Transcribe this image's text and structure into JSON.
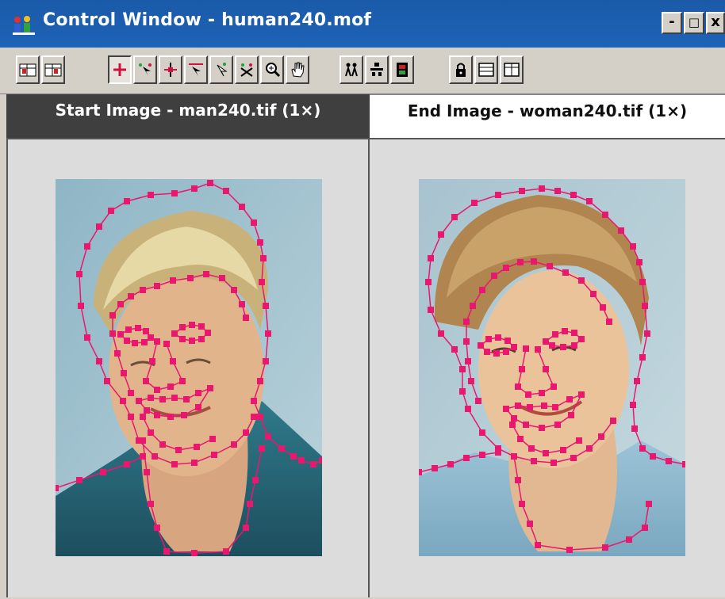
{
  "window": {
    "title": "Control Window - human240.mof",
    "controls": {
      "minimize": "-",
      "maximize": "□",
      "close": "x"
    }
  },
  "toolbar": {
    "buttons": [
      {
        "icon": "view-start-icon"
      },
      {
        "icon": "view-end-icon"
      },
      {
        "icon": "add-point-icon"
      },
      {
        "icon": "select-point-icon"
      },
      {
        "icon": "move-point-icon"
      },
      {
        "icon": "add-line-icon"
      },
      {
        "icon": "select-line-icon"
      },
      {
        "icon": "delete-point-icon"
      },
      {
        "icon": "zoom-icon"
      },
      {
        "icon": "pan-hand-icon"
      },
      {
        "icon": "morph-people-icon"
      },
      {
        "icon": "align-icon"
      },
      {
        "icon": "film-strip-icon"
      },
      {
        "icon": "lock-icon"
      },
      {
        "icon": "layout-single-icon"
      },
      {
        "icon": "layout-split-icon"
      }
    ]
  },
  "panes": {
    "start": {
      "title": "Start Image - man240.tif (1×)"
    },
    "end": {
      "title": "End Image - woman240.tif (1×)"
    }
  },
  "colors": {
    "titlebar": "#1d63b8",
    "control_point": "#e8186e",
    "line": "#e8186e"
  }
}
